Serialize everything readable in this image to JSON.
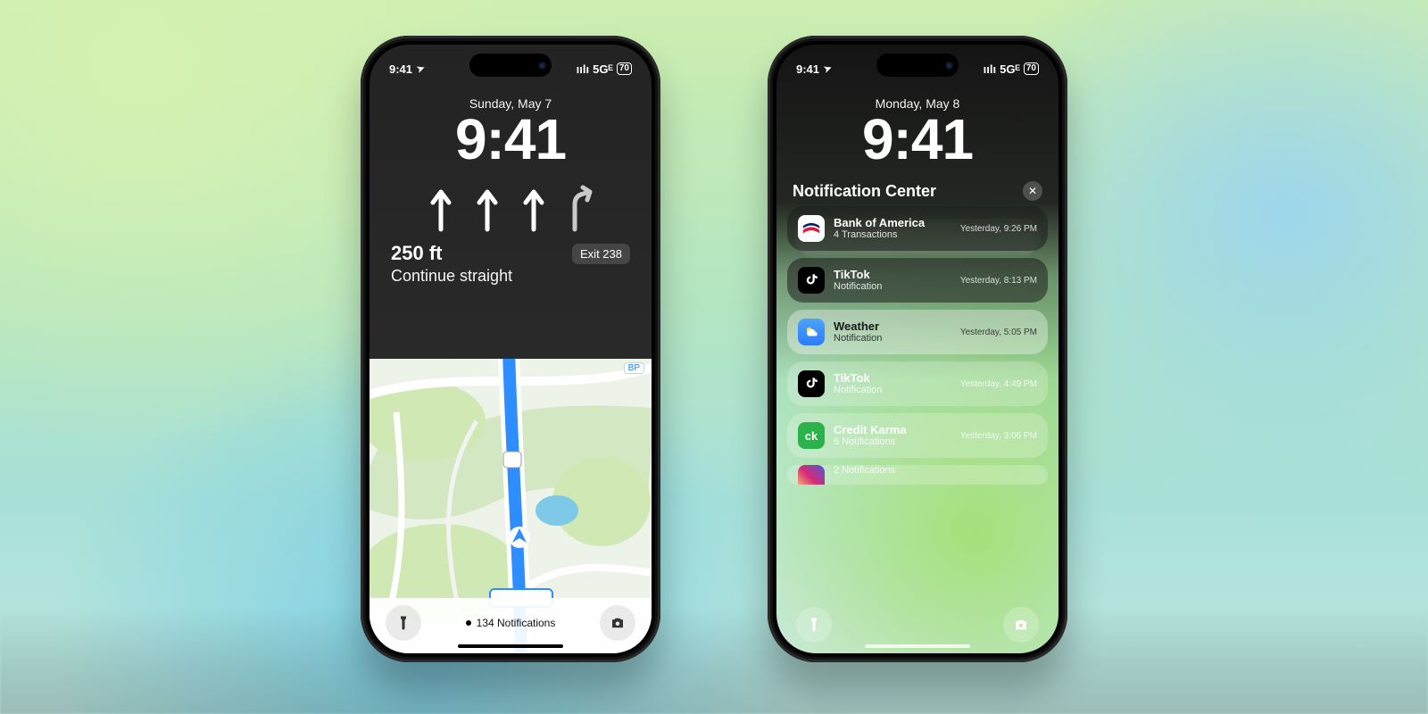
{
  "status": {
    "time": "9:41",
    "location_arrow": "➤",
    "signal_label": "5Gᴱ",
    "bars": "ıılı",
    "battery": "70"
  },
  "left": {
    "date": "Sunday, May 7",
    "time": "9:41",
    "nav": {
      "distance": "250 ft",
      "exit_pill": "Exit 238",
      "instruction": "Continue straight"
    },
    "map_marker": "BP",
    "notif_summary": "134 Notifications"
  },
  "right": {
    "date": "Monday, May 8",
    "time": "9:41",
    "nc_title": "Notification Center",
    "items": [
      {
        "app": "Bank of America",
        "sub": "4 Transactions",
        "ts": "Yesterday, 9:26 PM",
        "icon": "boa",
        "stacked": true
      },
      {
        "app": "TikTok",
        "sub": "Notification",
        "ts": "Yesterday, 8:13 PM",
        "icon": "tt"
      },
      {
        "app": "Weather",
        "sub": "Notification",
        "ts": "Yesterday, 5:05 PM",
        "icon": "wx"
      },
      {
        "app": "TikTok",
        "sub": "Notification",
        "ts": "Yesterday, 4:49 PM",
        "icon": "tt"
      },
      {
        "app": "Credit Karma",
        "sub": "6 Notifications",
        "ts": "Yesterday, 3:06 PM",
        "icon": "ck"
      },
      {
        "app": "",
        "sub": "2 Notifications",
        "ts": "",
        "icon": "ig",
        "cut": true
      }
    ]
  }
}
